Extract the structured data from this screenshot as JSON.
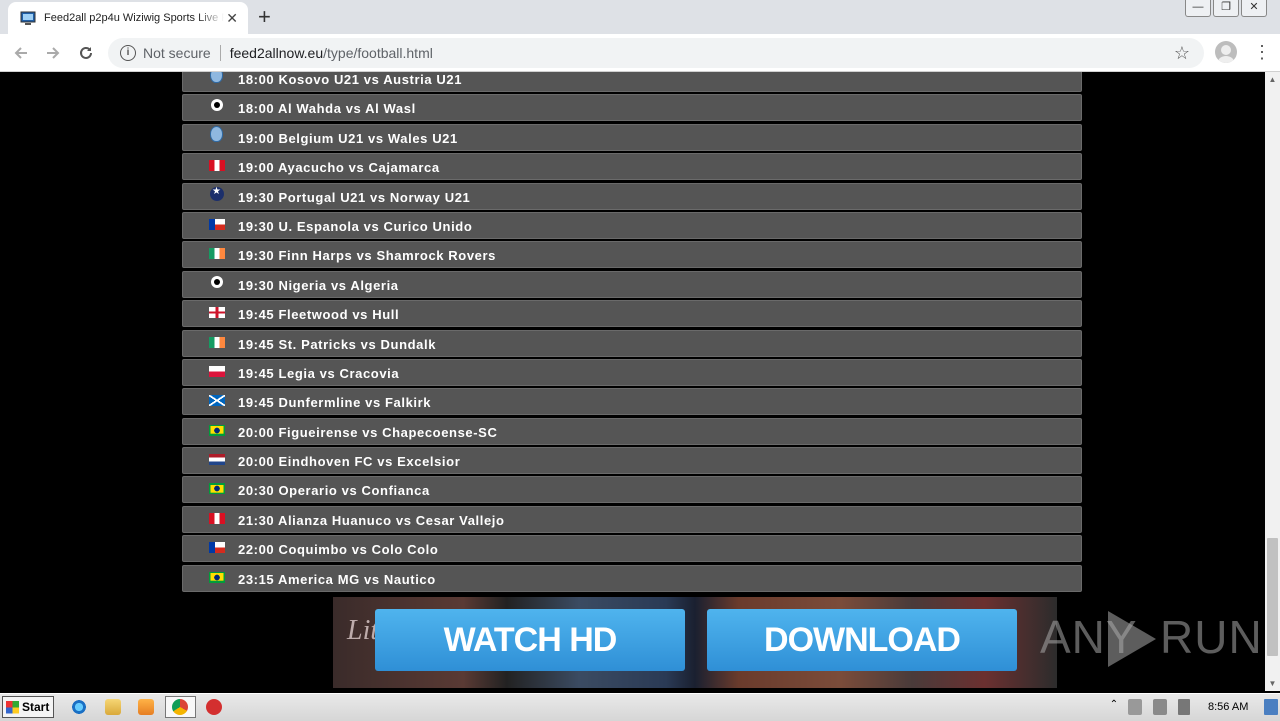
{
  "browser": {
    "tab_title": "Feed2all p2p4u Wiziwig Sports Live F",
    "tab_close": "✕",
    "new_tab": "+",
    "security_label": "Not secure",
    "url_host": "feed2allnow.eu",
    "url_path": "/type/football.html",
    "window_controls": [
      "—",
      "❐",
      "✕"
    ]
  },
  "matches": [
    {
      "icon": "uefa",
      "text": "18:00 Kosovo U21 vs Austria U21"
    },
    {
      "icon": "ball",
      "text": "18:00 Al Wahda vs Al Wasl"
    },
    {
      "icon": "uefa",
      "text": "19:00 Belgium U21 vs Wales U21"
    },
    {
      "icon": "peru",
      "text": "19:00 Ayacucho vs Cajamarca"
    },
    {
      "icon": "ucl",
      "text": "19:30 Portugal U21 vs Norway U21"
    },
    {
      "icon": "chile",
      "text": "19:30 U. Espanola vs Curico Unido"
    },
    {
      "icon": "ireland",
      "text": "19:30 Finn Harps vs Shamrock Rovers"
    },
    {
      "icon": "ball",
      "text": "19:30 Nigeria vs Algeria"
    },
    {
      "icon": "england",
      "text": "19:45 Fleetwood vs Hull"
    },
    {
      "icon": "ireland",
      "text": "19:45 St. Patricks vs Dundalk"
    },
    {
      "icon": "poland",
      "text": "19:45 Legia vs Cracovia"
    },
    {
      "icon": "scotland",
      "text": "19:45 Dunfermline vs Falkirk"
    },
    {
      "icon": "brazil",
      "text": "20:00 Figueirense vs Chapecoense-SC"
    },
    {
      "icon": "netherlands",
      "text": "20:00 Eindhoven FC vs Excelsior"
    },
    {
      "icon": "brazil",
      "text": "20:30 Operario vs Confianca"
    },
    {
      "icon": "peru",
      "text": "21:30 Alianza Huanuco vs Cesar Vallejo"
    },
    {
      "icon": "chile",
      "text": "22:00 Coquimbo vs Colo Colo"
    },
    {
      "icon": "brazil",
      "text": "23:15 America MG vs Nautico"
    }
  ],
  "ad": {
    "watch_label": "WATCH HD",
    "download_label": "DOWNLOAD",
    "script_text": "Little hands"
  },
  "watermark": {
    "left": "ANY",
    "right": "RUN"
  },
  "taskbar": {
    "start_label": "Start",
    "clock": "8:56 AM"
  },
  "colors": {
    "row_bg": "#555555",
    "row_border": "#6a6a6a",
    "button_blue": "#3aa0e4"
  }
}
